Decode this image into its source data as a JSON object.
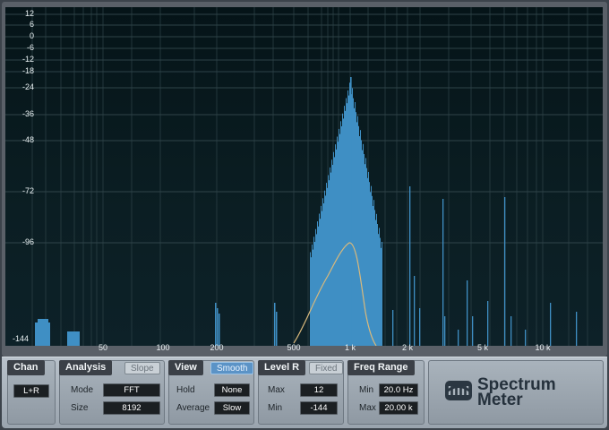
{
  "spectrum": {
    "y_labels": [
      "12",
      "6",
      "0",
      "-6",
      "-12",
      "-18",
      "-24",
      "-36",
      "-48",
      "-72",
      "-96",
      "-144"
    ],
    "x_labels": [
      "50",
      "100",
      "200",
      "500",
      "1 k",
      "2 k",
      "5 k",
      "10 k"
    ],
    "bar_color": "#3f8fc4",
    "curve_color": "#d9b97c"
  },
  "controls": {
    "chan": {
      "title": "Chan",
      "value": "L+R"
    },
    "analysis": {
      "title": "Analysis",
      "slope_label": "Slope",
      "mode_label": "Mode",
      "mode_value": "FFT",
      "size_label": "Size",
      "size_value": "8192"
    },
    "view": {
      "title": "View",
      "smooth_label": "Smooth",
      "hold_label": "Hold",
      "hold_value": "None",
      "average_label": "Average",
      "average_value": "Slow"
    },
    "level_r": {
      "title": "Level R",
      "fixed_label": "Fixed",
      "max_label": "Max",
      "max_value": "12",
      "min_label": "Min",
      "min_value": "-144"
    },
    "freq_range": {
      "title": "Freq Range",
      "min_label": "Min",
      "min_value": "20.0 Hz",
      "max_label": "Max",
      "max_value": "20.00 k"
    }
  },
  "brand": {
    "line1": "Spectrum",
    "line2": "Meter"
  }
}
